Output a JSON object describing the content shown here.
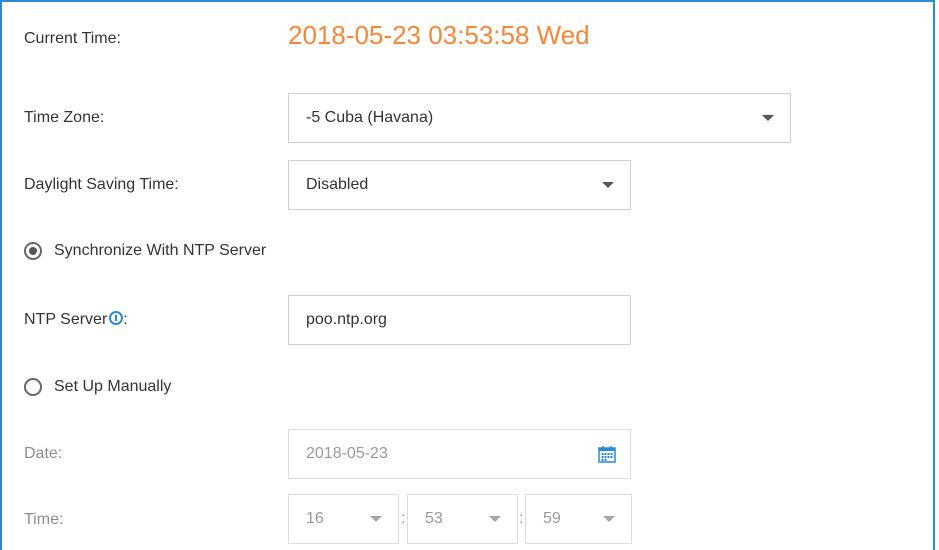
{
  "form": {
    "current_time_label": "Current Time:",
    "current_time_value": "2018-05-23 03:53:58 Wed",
    "time_zone_label": "Time Zone:",
    "time_zone_value": "-5 Cuba (Havana)",
    "dst_label": "Daylight Saving Time:",
    "dst_value": "Disabled",
    "sync_ntp_label": "Synchronize With NTP Server",
    "ntp_server_label": "NTP Server",
    "ntp_server_suffix": ":",
    "ntp_server_value": "poo.ntp.org",
    "manual_label": "Set Up Manually",
    "date_label": "Date:",
    "date_value": "2018-05-23",
    "time_label": "Time:",
    "time_hour": "16",
    "time_minute": "53",
    "time_second": "59",
    "separator": ":"
  },
  "icons": {
    "info": "info-icon",
    "calendar": "calendar-icon",
    "dropdown": "chevron-down-icon"
  },
  "colors": {
    "accent": "#2a8ad8",
    "time_value": "#f5863a"
  }
}
